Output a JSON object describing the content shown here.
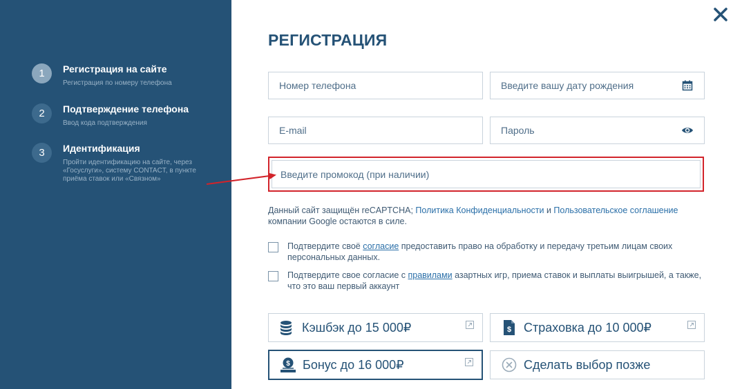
{
  "sidebar": {
    "steps": [
      {
        "number": "1",
        "title": "Регистрация на сайте",
        "desc": "Регистрация по номеру телефона"
      },
      {
        "number": "2",
        "title": "Подтверждение телефона",
        "desc": "Ввод кода подтверждения"
      },
      {
        "number": "3",
        "title": "Идентификация",
        "desc": "Пройти идентификацию на сайте, через «Госуслуги», систему CONTACT, в пункте приёма ставок или «Связном»"
      }
    ]
  },
  "form": {
    "title": "РЕГИСТРАЦИЯ",
    "phone_placeholder": "Номер телефона",
    "birthdate_placeholder": "Введите вашу дату рождения",
    "email_placeholder": "E-mail",
    "password_placeholder": "Пароль",
    "promo_placeholder": "Введите промокод (при наличии)",
    "recaptcha": {
      "text_before": "Данный сайт защищён reCAPTCHA; ",
      "privacy_link": "Политика Конфиденциальности",
      "and": " и ",
      "terms_link": "Пользовательское соглашение",
      "text_after": " компании Google остаются в силе."
    },
    "consent1": {
      "before": "Подтвердите своё ",
      "link": "согласие",
      "after": " предоставить право на обработку и передачу третьим лицам своих персональных данных."
    },
    "consent2": {
      "before": "Подтвердите свое согласие с ",
      "link": "правилами",
      "after": " азартных игр, приема ставок и выплаты выигрышей, а также, что это ваш первый аккаунт"
    },
    "bonuses": {
      "cashback": "Кэшбэк до 15 000₽",
      "insurance": "Страховка до 10 000₽",
      "bonus": "Бонус до 16 000₽",
      "later": "Сделать выбор позже"
    },
    "selected_bonus": "bonus"
  },
  "colors": {
    "sidebar_bg": "#255276",
    "accent": "#255276",
    "highlight": "#d2232a",
    "link": "#2a6fa8"
  }
}
